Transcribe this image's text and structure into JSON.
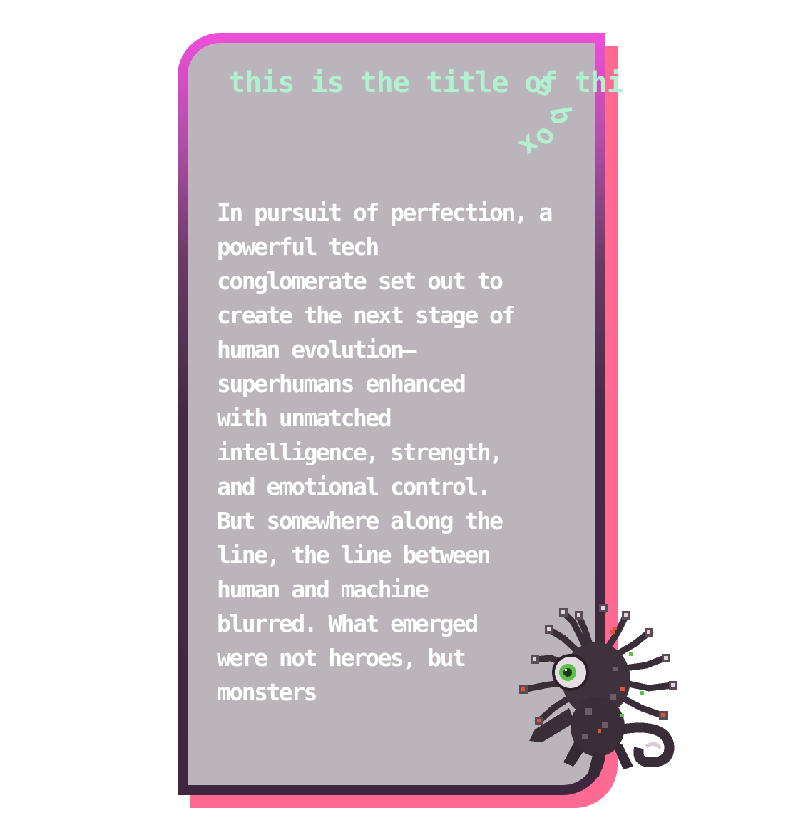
{
  "colors": {
    "frame_top": "#f04ed9",
    "frame_bottom": "#3f2740",
    "shadow": "#ff6a92",
    "panel": "#bbb5bb",
    "title": "#b2f0d2",
    "body_text": "#ffffff"
  },
  "card": {
    "title_main": "this is the title of thi",
    "title_curl": [
      "s",
      "b",
      "o",
      "x"
    ],
    "body_lines": [
      "In pursuit of perfection, a",
      "powerful tech",
      "conglomerate set out to",
      "create the next stage of",
      "human evolution—",
      "superhumans enhanced",
      "with unmatched",
      "intelligence, strength,",
      "and emotional control.",
      "But somewhere along the",
      "line, the line between",
      "human and machine",
      "blurred. What emerged",
      "were not heroes, but",
      "monsters"
    ],
    "illustration": "tentacled-eye-monster-sprite"
  }
}
